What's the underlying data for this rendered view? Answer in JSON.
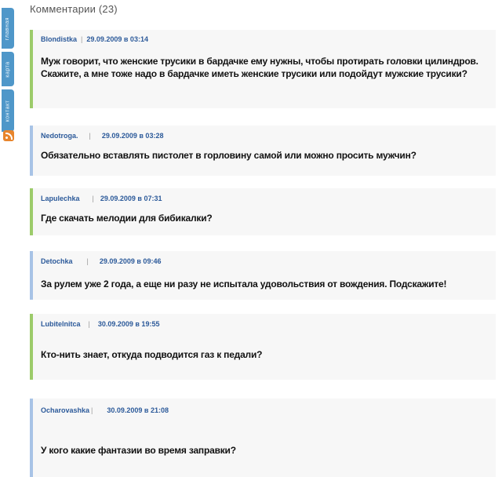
{
  "comments_header": "Комментарии (23)",
  "side_tabs": [
    "главная",
    "карта",
    "контакт"
  ],
  "rss_icon": "rss-icon",
  "comments": [
    {
      "author": "Blondistka",
      "date": "29.09.2009 в 03:14",
      "text": "Муж говорит, что женские трусики в бардачке ему нужны, чтобы протирать головки цилиндров. Скажите, а мне тоже надо в бардачке иметь женские трусики или подойдут мужские трусики?"
    },
    {
      "author": "Nedotroga.",
      "date": "29.09.2009 в 03:28",
      "text": "Обязательно вставлять пистолет в горловину самой или можно просить мужчин?"
    },
    {
      "author": "Lapulechka",
      "date": "29.09.2009 в 07:31",
      "text": "Где скачать мелодии для бибикалки?"
    },
    {
      "author": "Detochka",
      "date": "29.09.2009 в 09:46",
      "text": "За рулем уже 2 года, а еще ни разу не испытала удовольствия от вождения. Подскажите!"
    },
    {
      "author": "Lubitelnitca",
      "date": "30.09.2009 в 19:55",
      "text": "Кто-нить знает, откуда подводится газ к педали?"
    },
    {
      "author": "Ocharovashka",
      "date": "30.09.2009 в 21:08",
      "text": "У кого какие фантазии во время заправки?"
    }
  ]
}
